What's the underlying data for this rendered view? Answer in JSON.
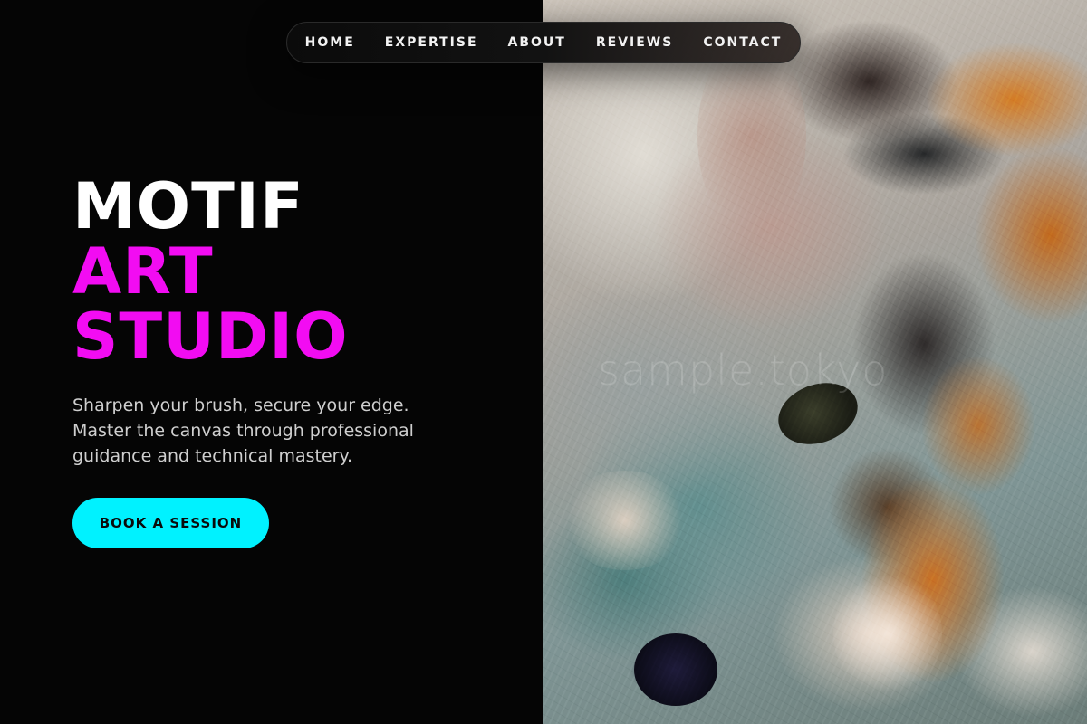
{
  "nav": {
    "items": [
      {
        "label": "HOME"
      },
      {
        "label": "EXPERTISE"
      },
      {
        "label": "ABOUT"
      },
      {
        "label": "REVIEWS"
      },
      {
        "label": "CONTACT"
      }
    ]
  },
  "hero": {
    "title_line1": "MOTIF",
    "title_line2": "ART",
    "title_line3": "STUDIO",
    "subtitle": "Sharpen your brush, secure your edge. Master the canvas through professional guidance and technical mastery.",
    "cta_label": "BOOK A SESSION"
  },
  "image": {
    "alt": "abstract-impasto-painting",
    "watermark": "sample.tokyo"
  },
  "colors": {
    "background": "#050505",
    "title_white": "#ffffff",
    "accent_magenta": "#f20cf2",
    "accent_cyan": "#00f2ff",
    "text_muted": "#cfcfcf"
  }
}
